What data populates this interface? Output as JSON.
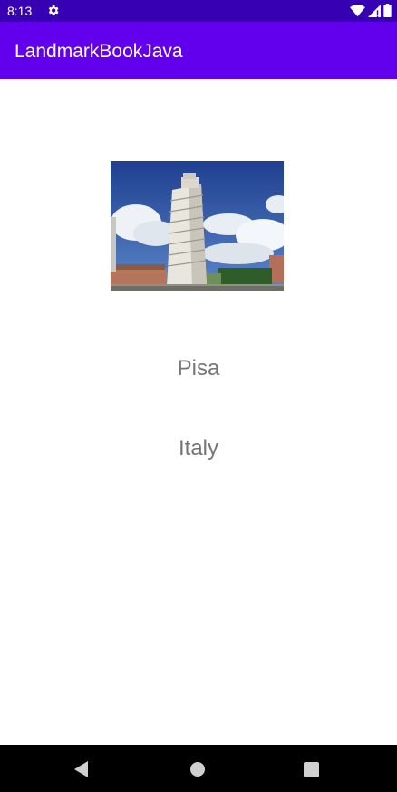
{
  "status_bar": {
    "time": "8:13",
    "icons": [
      "settings-icon",
      "wifi-icon",
      "signal-icon",
      "battery-icon"
    ]
  },
  "app_bar": {
    "title": "LandmarkBookJava"
  },
  "landmark": {
    "image": "leaning-tower-of-pisa-photo",
    "name": "Pisa",
    "country": "Italy"
  },
  "nav_bar": {
    "icons": [
      "back-icon",
      "home-icon",
      "recents-icon"
    ]
  },
  "colors": {
    "status_bar": "#3700B3",
    "app_bar": "#6200EE",
    "text": "#757575"
  }
}
